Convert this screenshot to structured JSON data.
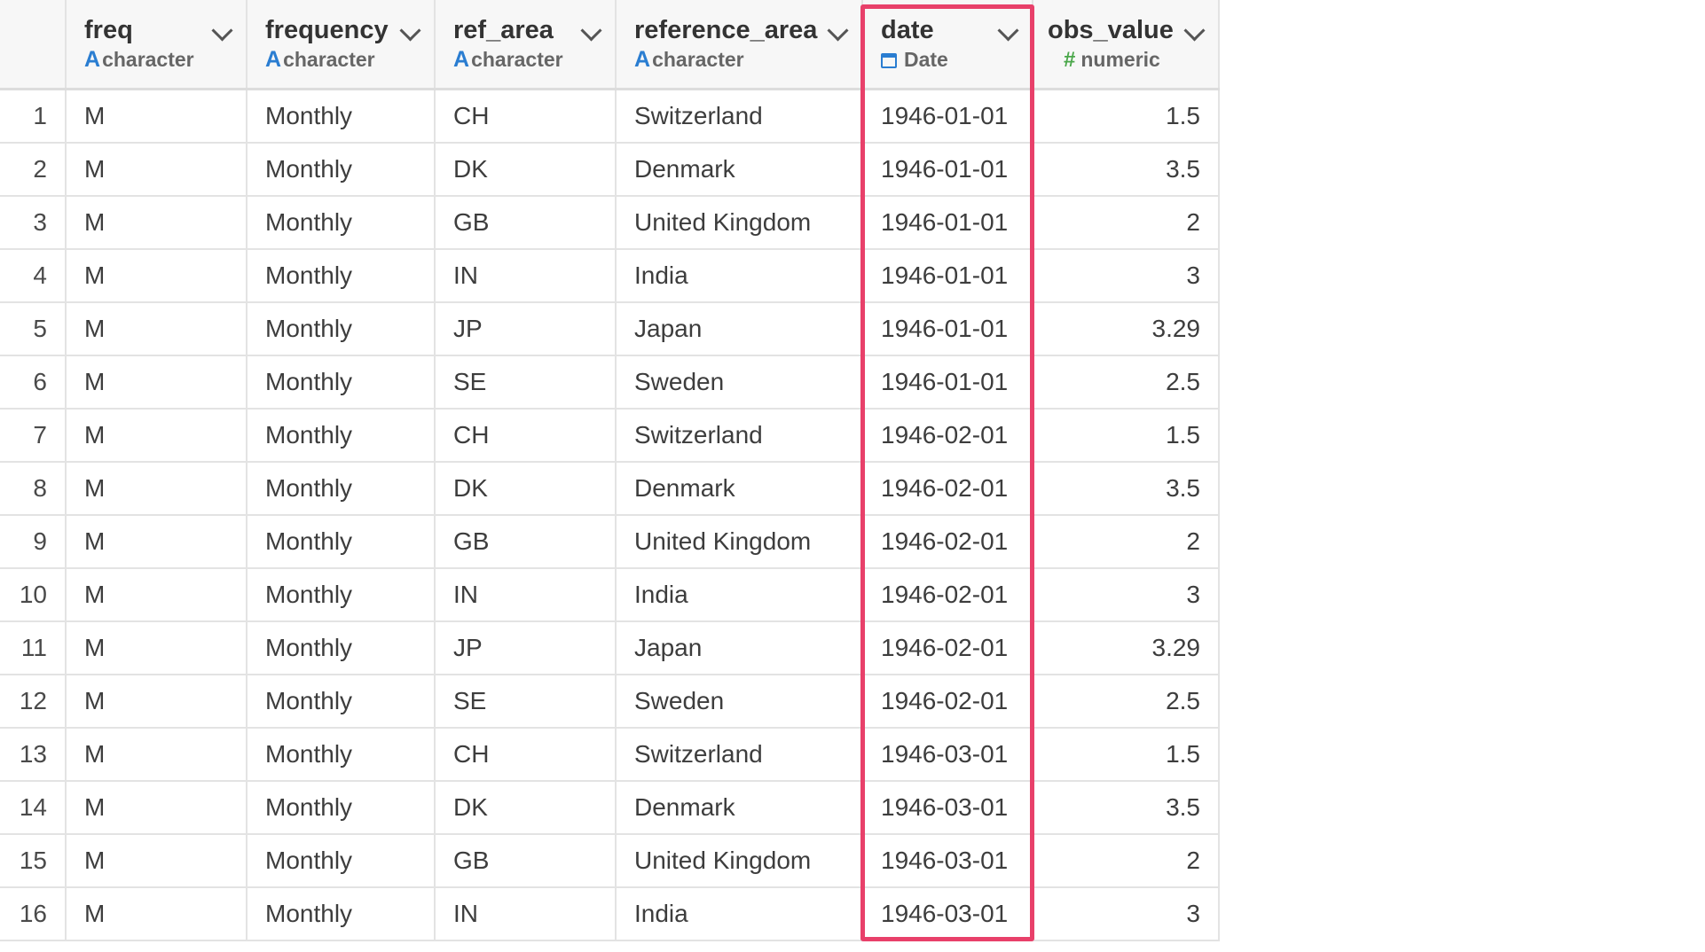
{
  "columns": [
    {
      "name": "freq",
      "type": "character",
      "icon": "character-type-icon"
    },
    {
      "name": "frequency",
      "type": "character",
      "icon": "character-type-icon"
    },
    {
      "name": "ref_area",
      "type": "character",
      "icon": "character-type-icon"
    },
    {
      "name": "reference_area",
      "type": "character",
      "icon": "character-type-icon"
    },
    {
      "name": "date",
      "type": "Date",
      "icon": "calendar-icon"
    },
    {
      "name": "obs_value",
      "type": "numeric",
      "icon": "hash-icon"
    }
  ],
  "type_glyphs": {
    "character": "A",
    "numeric": "#"
  },
  "highlight_color": "#e8406a",
  "rows": [
    [
      "1",
      "M",
      "Monthly",
      "CH",
      "Switzerland",
      "1946-01-01",
      "1.5"
    ],
    [
      "2",
      "M",
      "Monthly",
      "DK",
      "Denmark",
      "1946-01-01",
      "3.5"
    ],
    [
      "3",
      "M",
      "Monthly",
      "GB",
      "United Kingdom",
      "1946-01-01",
      "2"
    ],
    [
      "4",
      "M",
      "Monthly",
      "IN",
      "India",
      "1946-01-01",
      "3"
    ],
    [
      "5",
      "M",
      "Monthly",
      "JP",
      "Japan",
      "1946-01-01",
      "3.29"
    ],
    [
      "6",
      "M",
      "Monthly",
      "SE",
      "Sweden",
      "1946-01-01",
      "2.5"
    ],
    [
      "7",
      "M",
      "Monthly",
      "CH",
      "Switzerland",
      "1946-02-01",
      "1.5"
    ],
    [
      "8",
      "M",
      "Monthly",
      "DK",
      "Denmark",
      "1946-02-01",
      "3.5"
    ],
    [
      "9",
      "M",
      "Monthly",
      "GB",
      "United Kingdom",
      "1946-02-01",
      "2"
    ],
    [
      "10",
      "M",
      "Monthly",
      "IN",
      "India",
      "1946-02-01",
      "3"
    ],
    [
      "11",
      "M",
      "Monthly",
      "JP",
      "Japan",
      "1946-02-01",
      "3.29"
    ],
    [
      "12",
      "M",
      "Monthly",
      "SE",
      "Sweden",
      "1946-02-01",
      "2.5"
    ],
    [
      "13",
      "M",
      "Monthly",
      "CH",
      "Switzerland",
      "1946-03-01",
      "1.5"
    ],
    [
      "14",
      "M",
      "Monthly",
      "DK",
      "Denmark",
      "1946-03-01",
      "3.5"
    ],
    [
      "15",
      "M",
      "Monthly",
      "GB",
      "United Kingdom",
      "1946-03-01",
      "2"
    ],
    [
      "16",
      "M",
      "Monthly",
      "IN",
      "India",
      "1946-03-01",
      "3"
    ]
  ]
}
